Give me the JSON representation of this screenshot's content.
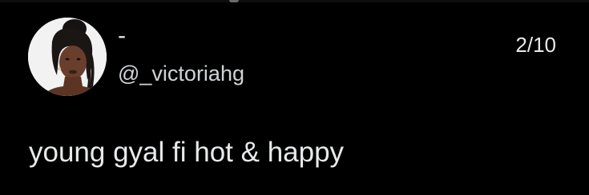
{
  "tweet": {
    "author": {
      "display_name": "-",
      "handle": "@_victoriahg",
      "avatar_icon": "user-avatar-photo"
    },
    "counter": "2/10",
    "text": "young gyal fi hot & happy"
  },
  "colors": {
    "background": "#000000",
    "text_primary": "#e7e9ea",
    "text_secondary": "#d0d3d6"
  }
}
